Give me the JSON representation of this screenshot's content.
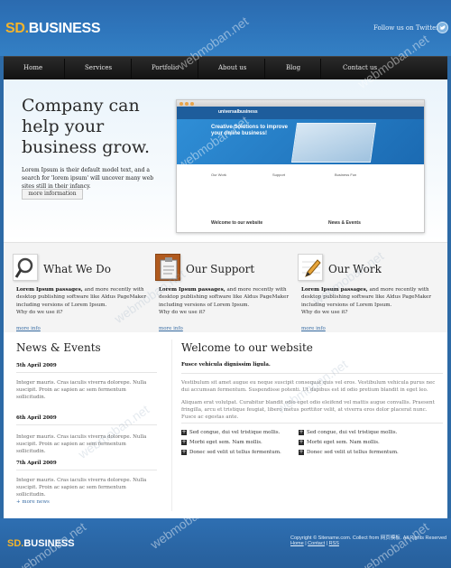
{
  "header": {
    "logo_sd": "SD",
    "logo_dot": ".",
    "logo_business": "BUSINESS",
    "follow_text": "Follow us on Twitter"
  },
  "nav": {
    "items": [
      "Home",
      "Services",
      "Portfolio",
      "About us",
      "Blog",
      "Contact us"
    ]
  },
  "hero": {
    "title": "Company can help your business grow.",
    "text": "Lorem Ipsum is their default model text, and a search for 'lorem ipsum' will uncover many web sites still in their infancy.",
    "button": "more information",
    "shot": {
      "logo": "universalbusiness",
      "banner_title": "Creative Solutions to improve your online business!",
      "cols": [
        "Our Work",
        "Support",
        "Business Fun"
      ],
      "foot_left": "Welcome to our website",
      "foot_right": "News & Events"
    }
  },
  "features": [
    {
      "title": "What We Do",
      "bold": "Lorem Ipsum passages,",
      "text": " and more recently with desktop publishing software like Aldus PageMaker including versions of Lorem Ipsum.",
      "why": "Why do we use it?",
      "more": "more info",
      "icon": "magnifier-icon"
    },
    {
      "title": "Our Support",
      "bold": "Lorem Ipsum passages,",
      "text": " and more recently with desktop publishing software like Aldus PageMaker including versions of Lorem Ipsum.",
      "why": "Why do we use it?",
      "more": "more info",
      "icon": "clipboard-icon"
    },
    {
      "title": "Our Work",
      "bold": "Lorem Ipsum passages,",
      "text": " and more recently with desktop publishing software like Aldus PageMaker including versions of Lorem Ipsum.",
      "why": "Why do we use it?",
      "more": "more info",
      "icon": "pencil-icon"
    }
  ],
  "news": {
    "title": "News & Events",
    "items": [
      {
        "date": "5th April 2009",
        "text": "Integer mauris. Cras iaculis viverra dolorepe. Nulla suscipit. Proin ac sapien ac sem fermentum sollicitudin."
      },
      {
        "date": "6th April 2009",
        "text": "Integer mauris. Cras iaculis viverra dolorepe. Nulla suscipit. Proin ac sapien ac sem fermentum sollicitudin."
      },
      {
        "date": "7th April 2009",
        "text": "Integer mauris. Cras iaculis viverra dolorepe. Nulla suscipit. Proin ac sapien ac sem fermentum sollicitudin."
      }
    ],
    "more": "+ more news"
  },
  "welcome": {
    "title": "Welcome to our website",
    "subtitle": "Fusce vehicula dignissim ligula.",
    "p1": "Vestibulum sit amet augue eu neque suscipit consequat quis vel eros. Vestibulum vehicula purus nec dui accumsan fermentum. Suspendisse potenti. Ut dapibus est id odio pretium blandit in eget leo.",
    "p2": "Aliquam erat volutpat. Curabitur blandit odio eget odio eleifend vel mattis augue convallis. Praesent fringilla, arcu et tristique feugiat, libero metus porttitor velit, at viverra eros dolor placerat nunc. Fusce ac egestas ante.",
    "list_left": [
      "Sed congue, dui vel tristique mollis.",
      "Morbi eget sem. Nam mollis.",
      "Donec sed velit ut tellus fermentum."
    ],
    "list_right": [
      "Sed congue, dui vel tristique mollis.",
      "Morbi eget sem. Nam mollis.",
      "Donec sed velit ut tellus fermentum."
    ]
  },
  "footer": {
    "logo_sd": "SD.",
    "logo_business": "BUSINESS",
    "copyright": "Copyright © Sitename.com. Collect from 网页模板. All Rights Reserved",
    "link_home": "Home",
    "link_contact": "Contact",
    "link_rss": "RSS",
    "sep": "|"
  },
  "watermark": "webmoban.net",
  "colors": {
    "brand_orange": "#f4b42b",
    "brand_blue": "#2d6aa6",
    "nav_bg": "#1a1a1a"
  }
}
